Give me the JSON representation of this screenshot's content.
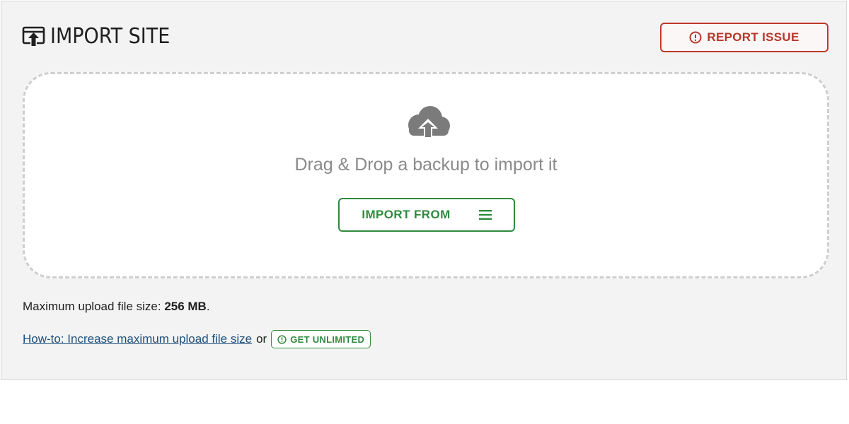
{
  "header": {
    "title": "IMPORT SITE",
    "icon": "import-site-icon"
  },
  "report_button": {
    "label": "REPORT ISSUE",
    "icon": "alert-circle-icon",
    "color": "#c0392b"
  },
  "dropzone": {
    "icon": "cloud-upload-icon",
    "text": "Drag & Drop a backup to import it",
    "import_button": {
      "label": "IMPORT FROM",
      "icon": "hamburger-menu-icon",
      "color": "#2f8a3e"
    }
  },
  "upload_info": {
    "prefix": "Maximum upload file size:",
    "value": "256 MB",
    "suffix": "."
  },
  "links": {
    "howto_label": "How-to: Increase maximum upload file size",
    "separator": "or",
    "unlimited_label": "GET UNLIMITED",
    "unlimited_icon": "alert-circle-icon"
  }
}
